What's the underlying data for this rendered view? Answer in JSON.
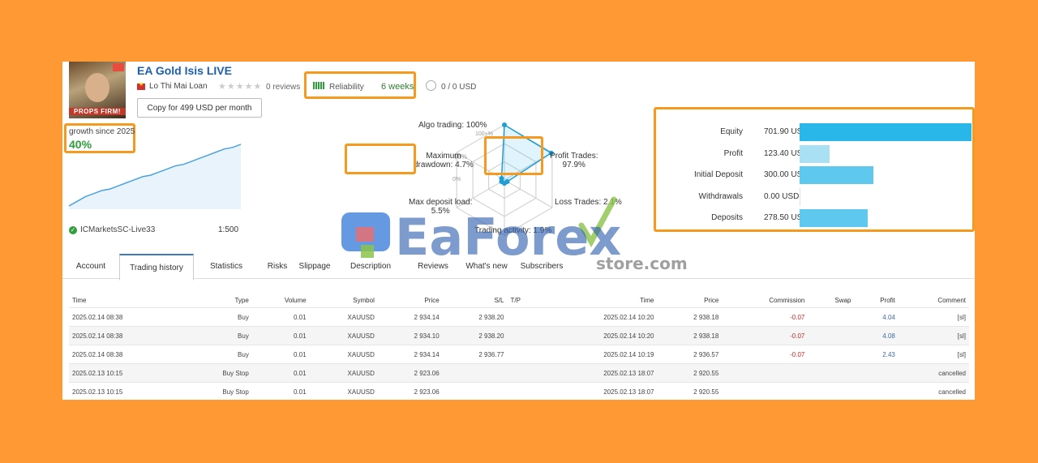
{
  "header": {
    "title": "EA Gold Isis LIVE",
    "author": "Lo Thi Mai Loan",
    "reviews": "0 reviews",
    "reliability_label": "Reliability",
    "reliability_weeks": "6 weeks",
    "funds": "0 / 0 USD",
    "copy_button": "Copy for 499 USD per month",
    "avatar_tag": "PROPS FIRM!"
  },
  "growth": {
    "label": "growth since 2025",
    "value": "40%",
    "broker": "ICMarketsSC-Live33",
    "leverage": "1:500",
    "series": [
      0,
      3,
      6,
      8,
      10,
      11,
      13,
      15,
      17,
      19,
      20,
      22,
      24,
      26,
      27,
      29,
      31,
      33,
      35,
      37,
      38,
      40
    ]
  },
  "radar": {
    "algo": "Algo trading: 100%",
    "ring_outer": "100+%",
    "ring_mid": "50%",
    "ring_inner": "0%",
    "drawdown_line1": "Maximum",
    "drawdown_line2": "drawdown: 4.7%",
    "profit_line1": "Profit Trades:",
    "profit_line2": "97.9%",
    "loss": "Loss Trades: 2.1%",
    "deposit_line1": "Max deposit load:",
    "deposit_line2": "5.5%",
    "activity": "Trading activity: 1.9%",
    "values": {
      "algo": 100,
      "profit": 97.9,
      "loss": 2.1,
      "activity": 1.9,
      "deposit": 5.5,
      "drawdown": 4.7
    }
  },
  "balance": [
    {
      "label": "Equity",
      "value": "701.90 USD",
      "amount": 701.9,
      "color": "#29B6E8"
    },
    {
      "label": "Profit",
      "value": "123.40 USD",
      "amount": 123.4,
      "color": "#A9E0F3"
    },
    {
      "label": "Initial Deposit",
      "value": "300.00 USD",
      "amount": 300.0,
      "color": "#5EC8EE"
    },
    {
      "label": "Withdrawals",
      "value": "0.00 USD",
      "amount": 0,
      "color": "#5EC8EE"
    },
    {
      "label": "Deposits",
      "value": "278.50 USD",
      "amount": 278.5,
      "color": "#5EC8EE"
    }
  ],
  "watermark": {
    "main": "EaForex",
    "sub": "store.com"
  },
  "tabs": [
    "Account",
    "Trading history",
    "Statistics",
    "Risks",
    "Slippage",
    "Description",
    "Reviews",
    "What's new",
    "Subscribers"
  ],
  "active_tab": "Trading history",
  "history": {
    "columns": [
      "Time",
      "Type",
      "Volume",
      "Symbol",
      "Price",
      "S/L",
      "T/P",
      "Time",
      "Price",
      "Commission",
      "Swap",
      "Profit",
      "Comment"
    ],
    "rows": [
      [
        "2025.02.14 08:38",
        "Buy",
        "0.01",
        "XAUUSD",
        "2 934.14",
        "2 938.20",
        "",
        "2025.02.14 10:20",
        "2 938.18",
        "-0.07",
        "",
        "4.04",
        "[sl]"
      ],
      [
        "2025.02.14 08:38",
        "Buy",
        "0.01",
        "XAUUSD",
        "2 934.10",
        "2 938.20",
        "",
        "2025.02.14 10:20",
        "2 938.18",
        "-0.07",
        "",
        "4.08",
        "[sl]"
      ],
      [
        "2025.02.14 08:38",
        "Buy",
        "0.01",
        "XAUUSD",
        "2 934.14",
        "2 936.77",
        "",
        "2025.02.14 10:19",
        "2 936.57",
        "-0.07",
        "",
        "2.43",
        "[sl]"
      ],
      [
        "2025.02.13 10:15",
        "Buy Stop",
        "0.01",
        "XAUUSD",
        "2 923.06",
        "",
        "",
        "2025.02.13 18:07",
        "2 920.55",
        "",
        "",
        "",
        "cancelled"
      ],
      [
        "2025.02.13 10:15",
        "Buy Stop",
        "0.01",
        "XAUUSD",
        "2 923.06",
        "",
        "",
        "2025.02.13 18:07",
        "2 920.55",
        "",
        "",
        "",
        "cancelled"
      ]
    ]
  }
}
